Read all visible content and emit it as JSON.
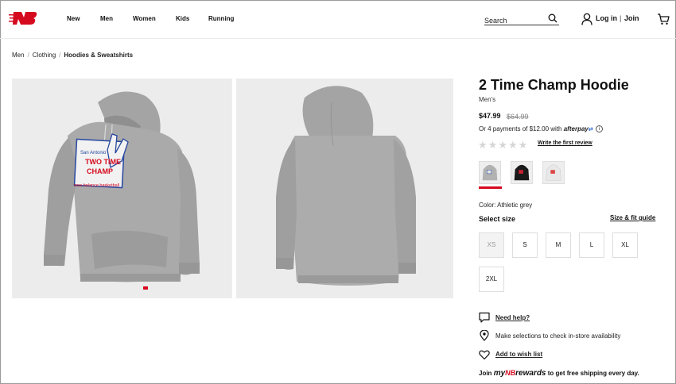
{
  "header": {
    "logo": "new-balance-logo",
    "nav": [
      {
        "label": "New"
      },
      {
        "label": "Men"
      },
      {
        "label": "Women"
      },
      {
        "label": "Kids"
      },
      {
        "label": "Running"
      }
    ],
    "search": {
      "placeholder": "Search",
      "icon": "search-icon"
    },
    "login_label": "Log in",
    "separator": "|",
    "join_label": "Join",
    "cart_icon": "cart-icon"
  },
  "breadcrumb": [
    {
      "label": "Men"
    },
    {
      "label": "Clothing"
    },
    {
      "label": "Hoodies & Sweatshirts"
    }
  ],
  "breadcrumb_sep": "/",
  "gallery": {
    "front_graphic_text": [
      "San Antonio",
      "TWO TIME",
      "CHAMP",
      "new balance basketball"
    ]
  },
  "product": {
    "title": "2 Time Champ Hoodie",
    "gender": "Men's",
    "price": "$47.99",
    "original_price": "$64.99",
    "afterpay_text": "Or 4 payments of $12.00 with",
    "afterpay_brand": "afterpay",
    "rating_stars": 0,
    "review_link": "Write the first review",
    "swatches": [
      {
        "name": "Athletic grey",
        "color": "#b9b9b9",
        "selected": true
      },
      {
        "name": "Black",
        "color": "#1a1a1a",
        "selected": false
      },
      {
        "name": "White",
        "color": "#e9e9e9",
        "selected": false
      }
    ],
    "color_label": "Color: Athletic grey",
    "size_label": "Select size",
    "size_guide_label": "Size & fit guide",
    "sizes": [
      {
        "label": "XS",
        "available": false
      },
      {
        "label": "S",
        "available": true
      },
      {
        "label": "M",
        "available": true
      },
      {
        "label": "L",
        "available": true
      },
      {
        "label": "XL",
        "available": true
      },
      {
        "label": "2XL",
        "available": true
      }
    ],
    "help_label": "Need help?",
    "store_text": "Make selections to check in-store availability",
    "wishlist_label": "Add to wish list",
    "rewards": {
      "prefix": "Join",
      "my": "my",
      "brand": "rewards",
      "suffix": "to get free shipping every day."
    }
  },
  "colors": {
    "brand_red": "#d50a1f",
    "image_bg": "#ececec",
    "hoodie_grey": "#a9a9a9"
  }
}
